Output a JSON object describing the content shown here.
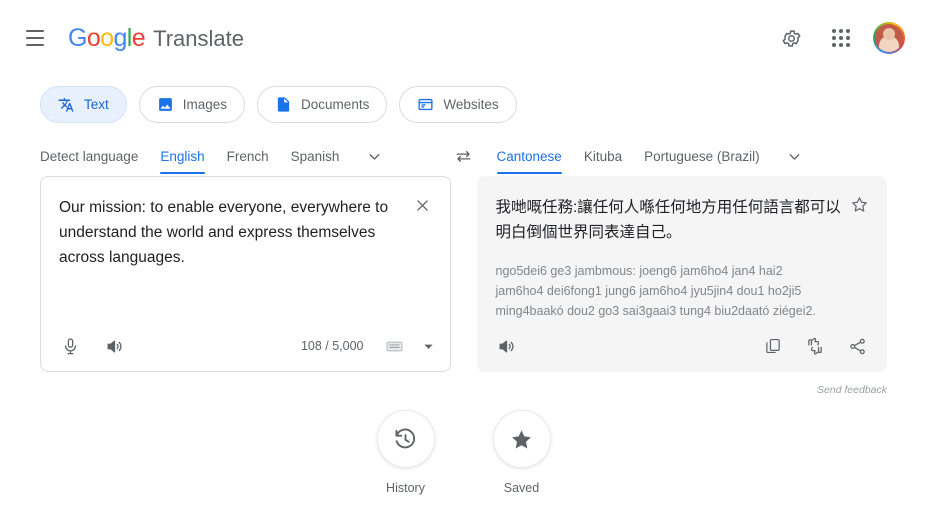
{
  "header": {
    "menu_icon": "hamburger-menu-icon",
    "logo_text": "Google",
    "product_name": "Translate",
    "settings_icon": "gear-icon",
    "apps_icon": "apps-grid-icon",
    "avatar_icon": "account-avatar"
  },
  "mode_tabs": [
    {
      "label": "Text",
      "icon": "translate-text-icon",
      "active": true
    },
    {
      "label": "Images",
      "icon": "image-icon",
      "active": false
    },
    {
      "label": "Documents",
      "icon": "document-icon",
      "active": false
    },
    {
      "label": "Websites",
      "icon": "website-icon",
      "active": false
    }
  ],
  "source": {
    "languages": [
      {
        "label": "Detect language",
        "active": false
      },
      {
        "label": "English",
        "active": true
      },
      {
        "label": "French",
        "active": false
      },
      {
        "label": "Spanish",
        "active": false
      }
    ],
    "more_icon": "chevron-down-icon",
    "text": "Our mission: to enable everyone, everywhere to understand the world and express themselves across languages.",
    "clear_icon": "close-icon",
    "mic_icon": "microphone-icon",
    "speaker_icon": "speaker-icon",
    "char_count": "108 / 5,000",
    "keyboard_icon": "keyboard-icon",
    "keyboard_caret_icon": "caret-down-icon"
  },
  "swap": {
    "icon": "swap-languages-icon"
  },
  "target": {
    "languages": [
      {
        "label": "Cantonese",
        "active": true
      },
      {
        "label": "Kituba",
        "active": false
      },
      {
        "label": "Portuguese (Brazil)",
        "active": false
      }
    ],
    "more_icon": "chevron-down-icon",
    "text": "我哋嘅任務:讓任何人喺任何地方用任何語言都可以明白倒個世界同表達自己。",
    "transliteration": "ngo5dei6 ge3 jambmous: joeng6 jam6ho4 jan4 hai2 jam6ho4 dei6fong1 jung6 jam6ho4 jyu5jin4 dou1 ho2ji5 ming4baakó dou2 go3 sai3gaai3 tung4 biu2daató ziégei2.",
    "star_icon": "star-outline-icon",
    "speaker_icon": "speaker-icon",
    "copy_icon": "copy-icon",
    "rate_icon": "rate-translation-icon",
    "share_icon": "share-icon"
  },
  "feedback_label": "Send feedback",
  "bottom_actions": [
    {
      "label": "History",
      "icon": "history-clock-icon"
    },
    {
      "label": "Saved",
      "icon": "star-filled-icon"
    }
  ],
  "colors": {
    "google_blue": "#4285F4",
    "google_red": "#EA4335",
    "google_yellow": "#FBBC05",
    "google_green": "#34A853",
    "accent_blue": "#1a73e8",
    "tab_active_bg": "#e8f0fe",
    "target_panel_bg": "#f5f5f5",
    "muted_text": "#5f6368"
  }
}
